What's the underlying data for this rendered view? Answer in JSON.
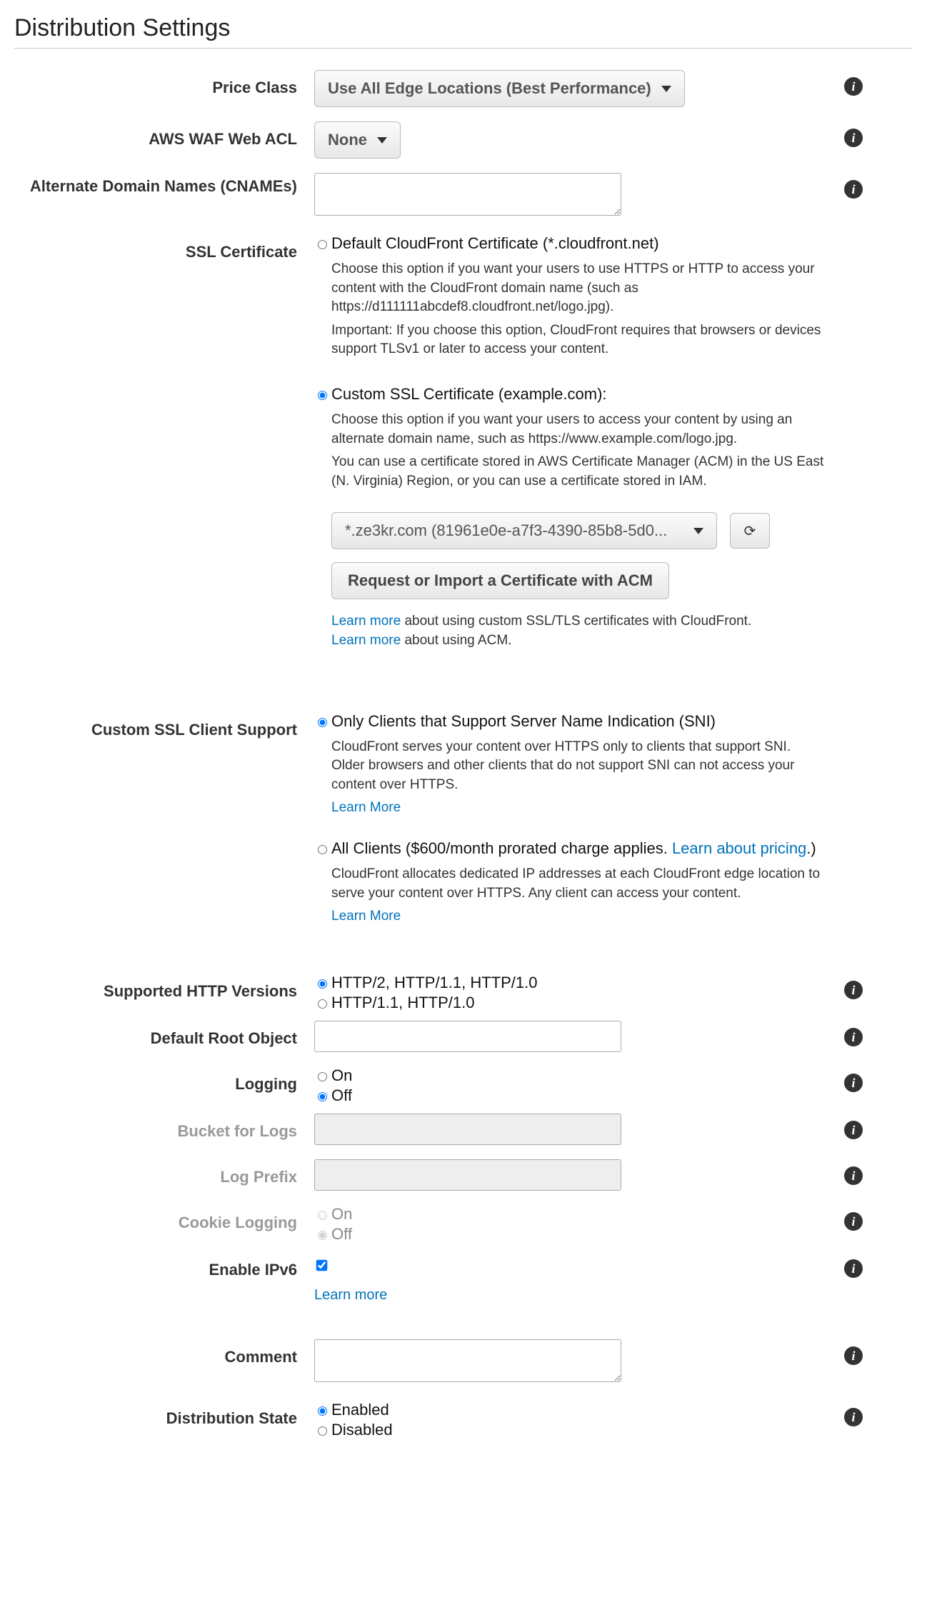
{
  "title": "Distribution Settings",
  "priceClass": {
    "label": "Price Class",
    "value": "Use All Edge Locations (Best Performance)"
  },
  "wafAcl": {
    "label": "AWS WAF Web ACL",
    "value": "None"
  },
  "cnames": {
    "label": "Alternate Domain Names (CNAMEs)"
  },
  "sslCert": {
    "label": "SSL Certificate",
    "default": {
      "label": "Default CloudFront Certificate (*.cloudfront.net)",
      "desc1": "Choose this option if you want your users to use HTTPS or HTTP to access your content with the CloudFront domain name (such as https://d111111abcdef8.cloudfront.net/logo.jpg).",
      "desc2": "Important: If you choose this option, CloudFront requires that browsers or devices support TLSv1 or later to access your content."
    },
    "custom": {
      "label": "Custom SSL Certificate (example.com):",
      "desc1": "Choose this option if you want your users to access your content by using an alternate domain name, such as https://www.example.com/logo.jpg.",
      "desc2": "You can use a certificate stored in AWS Certificate Manager (ACM) in the US East (N. Virginia) Region, or you can use a certificate stored in IAM.",
      "selected": "*.ze3kr.com (81961e0e-a7f3-4390-85b8-5d0...",
      "requestBtn": "Request or Import a Certificate with ACM",
      "learn1pre": "Learn more",
      "learn1post": " about using custom SSL/TLS certificates with CloudFront.",
      "learn2pre": "Learn more",
      "learn2post": " about using ACM."
    }
  },
  "clientSupport": {
    "label": "Custom SSL Client Support",
    "sni": {
      "label": "Only Clients that Support Server Name Indication (SNI)",
      "desc": "CloudFront serves your content over HTTPS only to clients that support SNI. Older browsers and other clients that do not support SNI can not access your content over HTTPS.",
      "learn": "Learn More"
    },
    "all": {
      "labelPre": "All Clients ($600/month prorated charge applies. ",
      "learnLink": "Learn about pricing",
      "labelPost": ".)",
      "desc": "CloudFront allocates dedicated IP addresses at each CloudFront edge location to serve your content over HTTPS. Any client can access your content.",
      "learn": "Learn More"
    }
  },
  "httpVersions": {
    "label": "Supported HTTP Versions",
    "opt1": "HTTP/2, HTTP/1.1, HTTP/1.0",
    "opt2": "HTTP/1.1, HTTP/1.0"
  },
  "rootObj": {
    "label": "Default Root Object"
  },
  "logging": {
    "label": "Logging",
    "on": "On",
    "off": "Off"
  },
  "bucketLogs": {
    "label": "Bucket for Logs"
  },
  "logPrefix": {
    "label": "Log Prefix"
  },
  "cookieLogging": {
    "label": "Cookie Logging",
    "on": "On",
    "off": "Off"
  },
  "ipv6": {
    "label": "Enable IPv6",
    "learn": "Learn more"
  },
  "comment": {
    "label": "Comment"
  },
  "state": {
    "label": "Distribution State",
    "enabled": "Enabled",
    "disabled": "Disabled"
  }
}
